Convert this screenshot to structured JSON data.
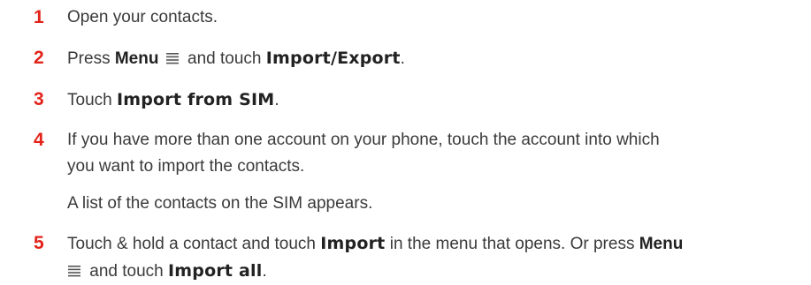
{
  "steps": [
    {
      "number": "1",
      "text": "Open your contacts."
    },
    {
      "number": "2",
      "pre": "Press ",
      "bold1": "Menu",
      "mid": " and touch ",
      "bold2": "Import/Export",
      "post": "."
    },
    {
      "number": "3",
      "pre": "Touch ",
      "bold1": "Import from SIM",
      "post": "."
    },
    {
      "number": "4",
      "line1": "If you have more than one account on your phone, touch the account into which",
      "line2": "you want to import the contacts."
    },
    {
      "number": "5",
      "pre": "Touch & hold a contact and touch ",
      "bold1": "Import",
      "mid": " in the menu that opens. Or press ",
      "bold2": "Menu",
      "line2_pre": " and touch ",
      "bold3": "Import all",
      "post": "."
    }
  ],
  "note": "A list of the contacts on the SIM appears.",
  "icons": {
    "menu": "menu-icon"
  },
  "colors": {
    "step_number": "#e2231a",
    "text": "#3a3a3a"
  }
}
